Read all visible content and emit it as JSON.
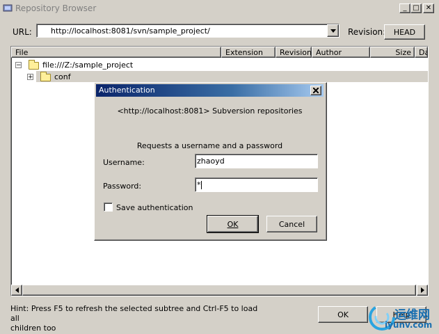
{
  "window": {
    "title": "Repository Browser",
    "controls": [
      "_",
      "□",
      "✕"
    ]
  },
  "header": {
    "url_label": "URL:",
    "url_value": "http://localhost:8081/svn/sample_project/",
    "revision_label": "Revision:",
    "head_button": "HEAD"
  },
  "table": {
    "columns": [
      "File",
      "Extension",
      "Revision",
      "Author",
      "Size",
      "Da"
    ],
    "rows": [
      {
        "expander": "−",
        "name": "file:///Z:/sample_project"
      },
      {
        "expander": "+",
        "name": "conf"
      }
    ]
  },
  "footer": {
    "hint_line1": "Hint: Press F5 to refresh the selected subtree and Ctrl-F5 to load all",
    "hint_line2": "children too",
    "ok_button": "OK",
    "help_button": "Help"
  },
  "dialog": {
    "title": "Authentication",
    "realm": "<http://localhost:8081> Subversion repositories",
    "prompt": "Requests a username and a password",
    "username_label": "Username:",
    "username_value": "zhaoyd",
    "password_label": "Password:",
    "password_value": "*",
    "save_label": "Save authentication",
    "save_checked": false,
    "ok_button": "OK",
    "cancel_button": "Cancel"
  },
  "watermark": {
    "text_top": "运维网",
    "text_bottom": "iyunv.com"
  }
}
